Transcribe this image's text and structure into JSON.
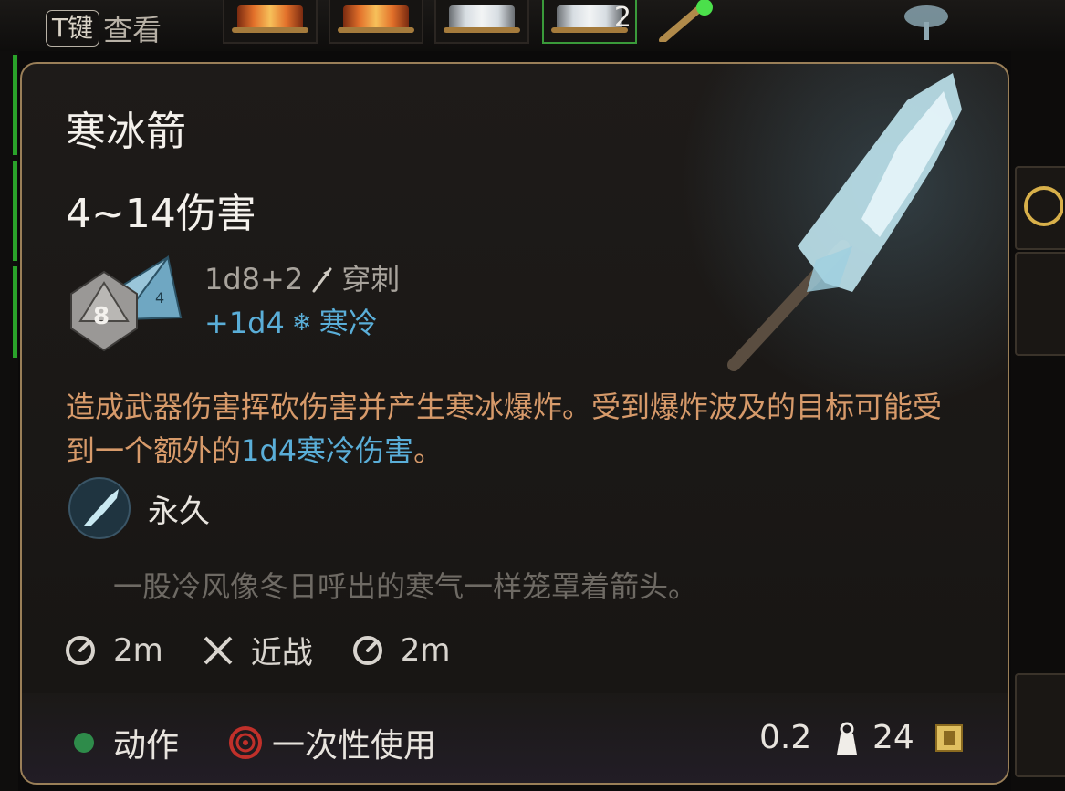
{
  "hotbar": {
    "key_badge": "T键",
    "key_action": "查看",
    "selected_slot_count": "2"
  },
  "tooltip": {
    "title": "寒冰箭",
    "damage": "4~14伤害",
    "dice": {
      "d8_label": "8",
      "d4_label": "4"
    },
    "base_damage": "1d8+2",
    "base_damage_type": "穿刺",
    "bonus_damage": "+1d4",
    "bonus_damage_type": "寒冷",
    "description_part1": "造成武器伤害挥砍伤害并产生寒冰爆炸。受到爆炸波及的目标可能受到一个额外的",
    "description_highlight": "1d4寒冷伤害",
    "description_part2": "。",
    "duration_label": "永久",
    "flavor_text": "一股冷风像冬日呼出的寒气一样笼罩着箭头。",
    "stats": {
      "range_value": "2m",
      "attack_type": "近战",
      "aoe_value": "2m"
    },
    "footer": {
      "action_label": "动作",
      "usage_label": "一次性使用",
      "weight": "0.2",
      "value": "24"
    }
  },
  "colors": {
    "highlight_blue": "#5aaed8",
    "description_orange": "#d79a6a",
    "action_green": "#2e8b4a",
    "border_gold": "#9a7f58"
  }
}
